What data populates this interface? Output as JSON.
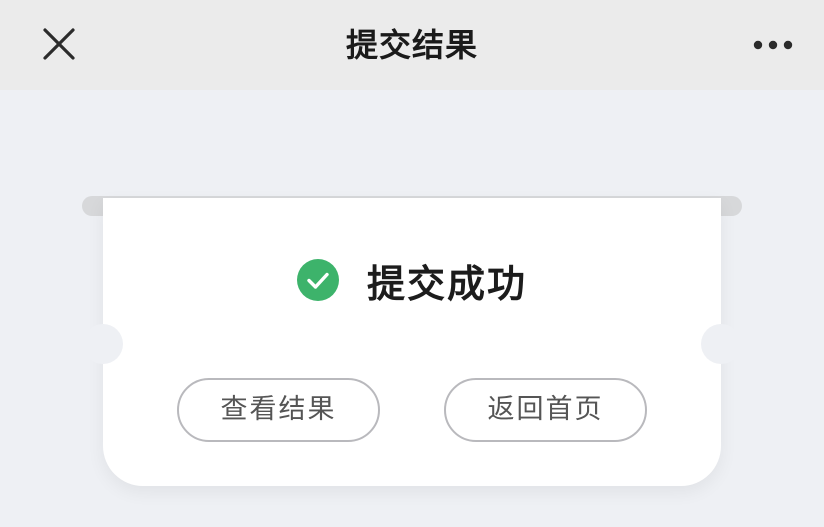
{
  "navbar": {
    "title": "提交结果",
    "close_icon": "close-icon",
    "more_icon": "more-dots-icon"
  },
  "result": {
    "status_text": "提交成功",
    "status_icon": "check-circle-icon",
    "success_color": "#3db36b"
  },
  "actions": {
    "view_result_label": "查看结果",
    "back_home_label": "返回首页"
  }
}
